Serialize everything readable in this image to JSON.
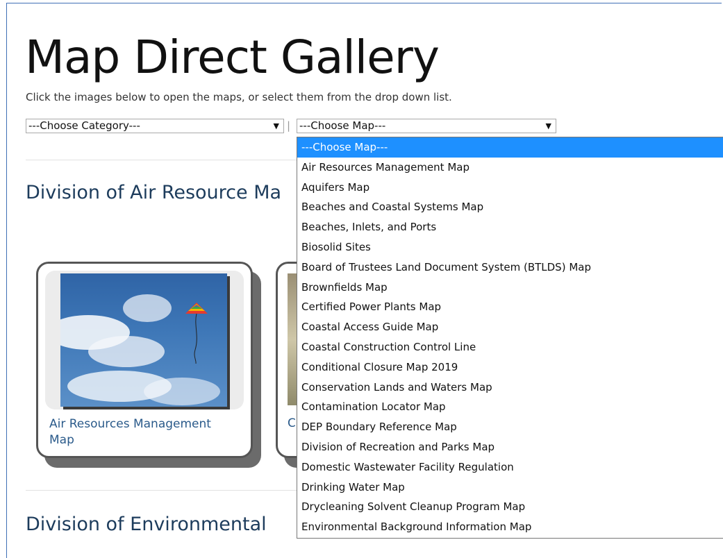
{
  "page": {
    "title": "Map Direct Gallery",
    "subtitle": "Click the images below to open the maps, or select them from the drop down list.",
    "separator": "|"
  },
  "filters": {
    "category_select": {
      "value": "---Choose Category---"
    },
    "map_select": {
      "value": "---Choose Map---"
    }
  },
  "sections": [
    {
      "heading": "Division of Air Resource Ma"
    },
    {
      "heading": "Division of Environmental"
    }
  ],
  "cards": [
    {
      "caption": "Air Resources Management Map"
    },
    {
      "caption": "C"
    }
  ],
  "map_dropdown": {
    "options": [
      "---Choose Map---",
      "Air Resources Management Map",
      "Aquifers Map",
      "Beaches and Coastal Systems Map",
      "Beaches, Inlets, and Ports",
      "Biosolid Sites",
      "Board of Trustees Land Document System (BTLDS) Map",
      "Brownfields Map",
      "Certified Power Plants Map",
      "Coastal Access Guide Map",
      "Coastal Construction Control Line",
      "Conditional Closure Map 2019",
      "Conservation Lands and Waters Map",
      "Contamination Locator Map",
      "DEP Boundary Reference Map",
      "Division of Recreation and Parks Map",
      "Domestic Wastewater Facility Regulation",
      "Drinking Water Map",
      "Drycleaning Solvent Cleanup Program Map",
      "Environmental Background Information Map"
    ],
    "highlighted_index": 0
  },
  "colors": {
    "accent": "#1e90ff",
    "heading": "#1d3c5c",
    "link": "#2a5a8a"
  }
}
